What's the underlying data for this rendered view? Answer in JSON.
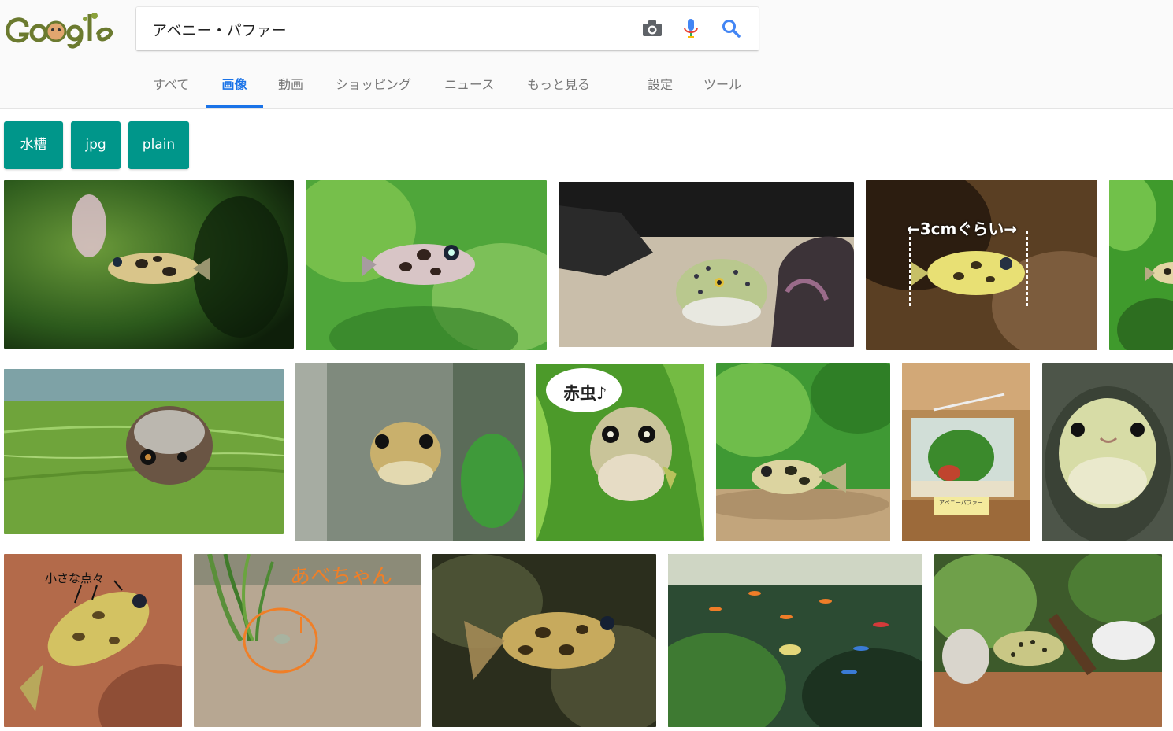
{
  "logo": {
    "text": "Google"
  },
  "search": {
    "query": "アベニー・パファー",
    "camera_icon": "camera-icon",
    "mic_icon": "microphone-icon",
    "search_icon": "search-icon"
  },
  "tabs": [
    {
      "label": "すべて"
    },
    {
      "label": "画像",
      "active": true
    },
    {
      "label": "動画"
    },
    {
      "label": "ショッピング"
    },
    {
      "label": "ニュース"
    },
    {
      "label": "もっと見る"
    },
    {
      "label": "設定"
    },
    {
      "label": "ツール"
    }
  ],
  "chips": [
    {
      "label": "水槽"
    },
    {
      "label": "jpg"
    },
    {
      "label": "plain"
    }
  ],
  "image_captions": {
    "size": "←3cmぐらい→",
    "akamushi": "赤虫♪",
    "spots": "小さな点々",
    "abechan": "あべちゃん",
    "shop_tag": "アベニーパファー"
  },
  "colors": {
    "accent_blue": "#1a73e8",
    "chip_teal": "#00968a"
  }
}
